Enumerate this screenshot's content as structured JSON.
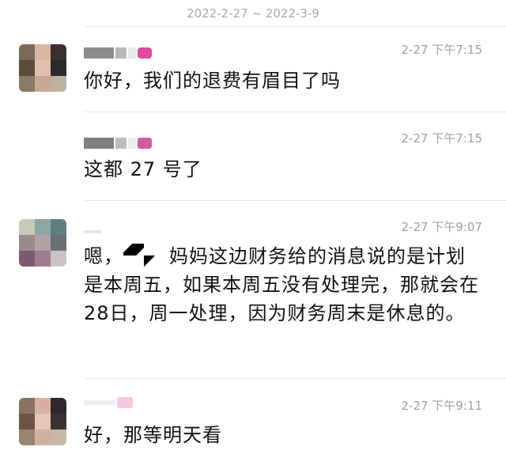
{
  "date_range": "2022-2-27 ~ 2022-3-9",
  "messages": [
    {
      "time": "2-27 下午7:15",
      "text": "你好，我们的退费有眉目了吗"
    },
    {
      "time": "2-27 下午7:15",
      "text": "这都 27 号了"
    },
    {
      "time": "2-27 下午9:07",
      "text_start": "嗯，",
      "text_end": "妈妈这边财务给的消息说的是计划是本周五，如果本周五没有处理完，那就会在28日，周一处理，因为财务周末是休息的。"
    },
    {
      "time": "2-27 下午9:11",
      "text": "好，那等明天看"
    }
  ]
}
